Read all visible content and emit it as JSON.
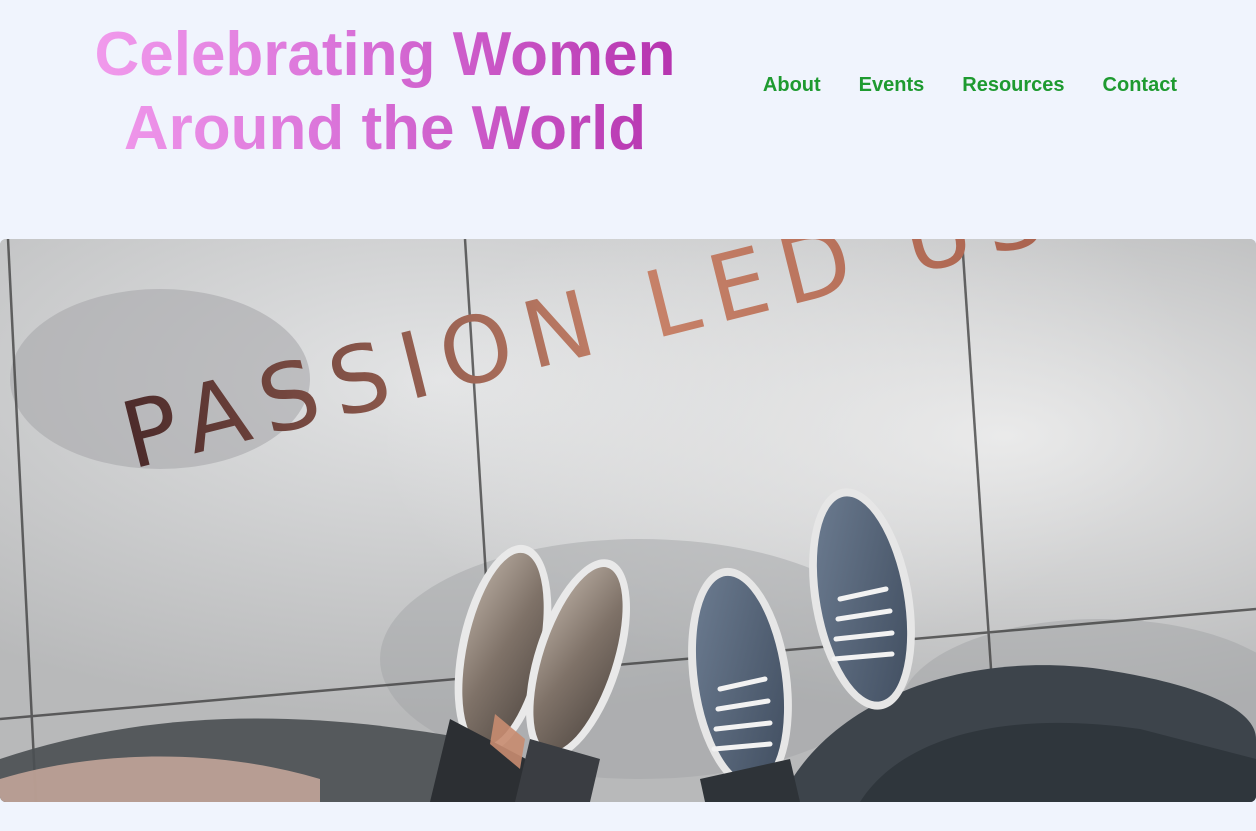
{
  "header": {
    "title_line1": "Celebrating Women",
    "title_line2": "Around the World"
  },
  "nav": {
    "items": [
      {
        "label": "About"
      },
      {
        "label": "Events"
      },
      {
        "label": "Resources"
      },
      {
        "label": "Contact"
      }
    ]
  },
  "hero": {
    "pavement_text": "PASSION LED US HERE",
    "colors": {
      "pavement": "#b9babb",
      "lettering": "#8a4a3c",
      "nav_link": "#1e9a30"
    }
  }
}
